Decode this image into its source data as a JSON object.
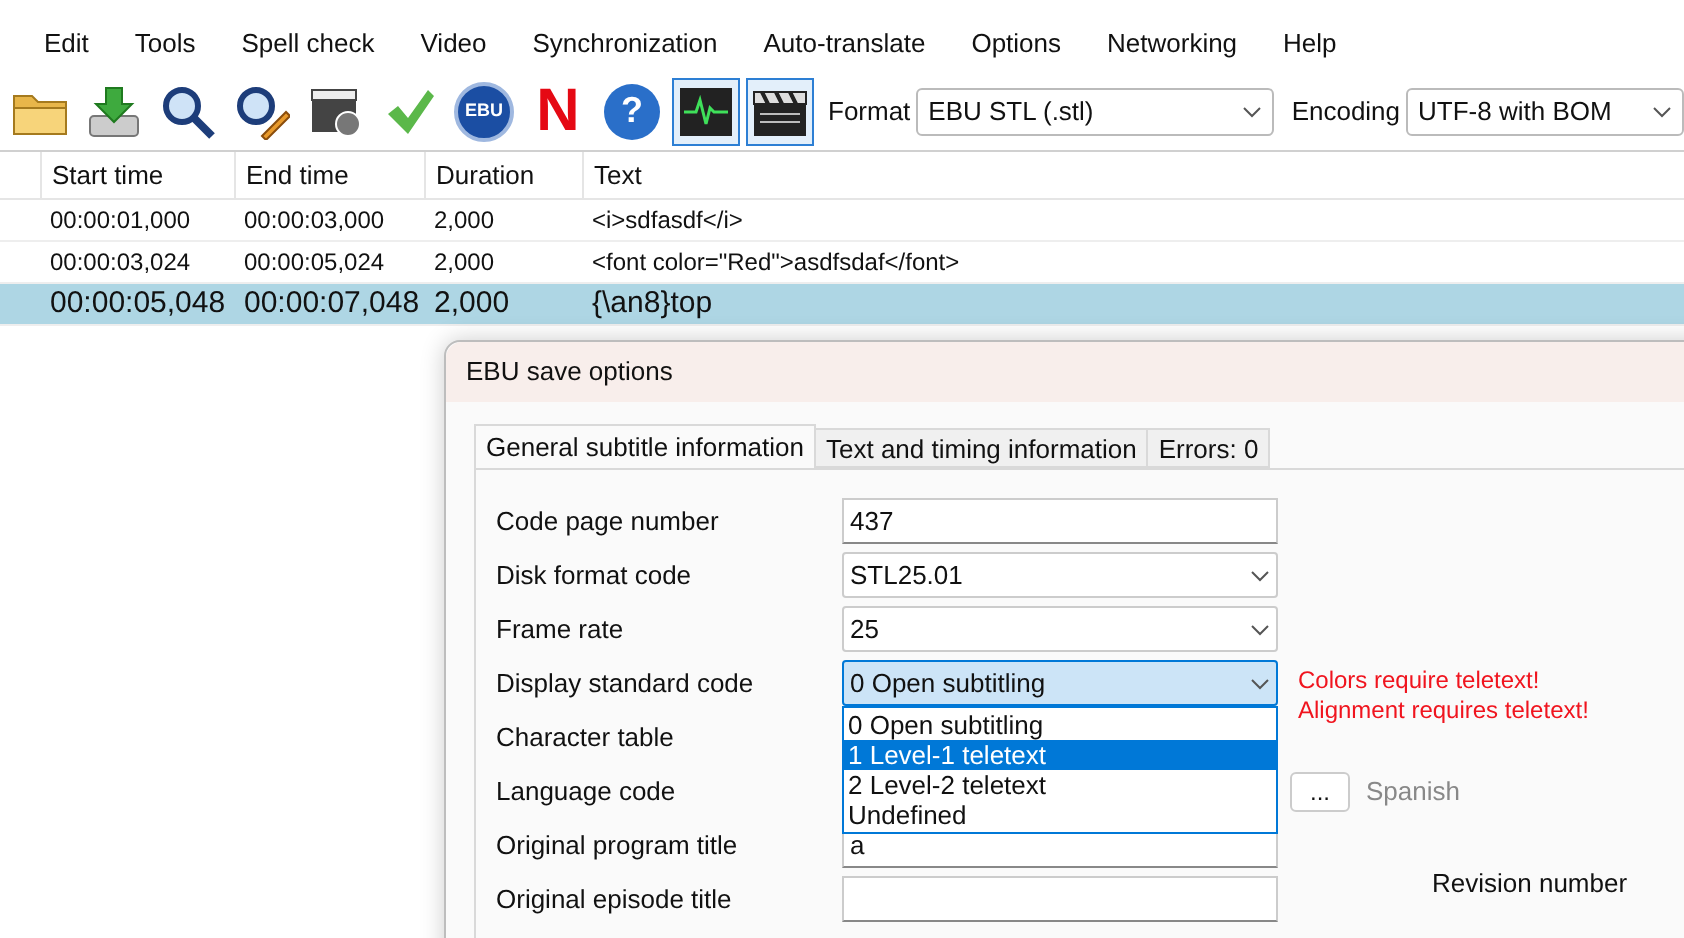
{
  "menu": [
    "Edit",
    "Tools",
    "Spell check",
    "Video",
    "Synchronization",
    "Auto-translate",
    "Options",
    "Networking",
    "Help"
  ],
  "toolbar": {
    "buttons": [
      {
        "kind": "folder"
      },
      {
        "kind": "download"
      },
      {
        "kind": "search"
      },
      {
        "kind": "replace"
      },
      {
        "kind": "clapper-clock"
      },
      {
        "kind": "check"
      },
      {
        "kind": "ebu",
        "text": "EBU",
        "pressed": false
      },
      {
        "kind": "netflix",
        "text": "N"
      },
      {
        "kind": "help",
        "text": "?"
      },
      {
        "kind": "waveform",
        "pressed": true
      },
      {
        "kind": "video",
        "pressed": true
      }
    ],
    "format": {
      "label": "Format",
      "value": "EBU STL (.stl)"
    },
    "encoding": {
      "label": "Encoding",
      "value": "UTF-8 with BOM"
    }
  },
  "table": {
    "columns": [
      "Start time",
      "End time",
      "Duration",
      "Text"
    ],
    "rows": [
      {
        "cells": [
          "00:00:01,000",
          "00:00:03,000",
          "2,000",
          "<i>sdfasdf</i>"
        ],
        "selected": false
      },
      {
        "cells": [
          "00:00:03,024",
          "00:00:05,024",
          "2,000",
          "<font color=\"Red\">asdfsdaf</font>"
        ],
        "selected": false
      },
      {
        "cells": [
          "00:00:05,048",
          "00:00:07,048",
          "2,000",
          "{\\an8}top"
        ],
        "selected": true
      }
    ]
  },
  "dialog": {
    "title": "EBU save options",
    "tabs": [
      {
        "label": "General subtitle information",
        "selected": true
      },
      {
        "label": "Text and timing information",
        "selected": false
      },
      {
        "label": "Errors: 0",
        "selected": false
      }
    ],
    "fields": [
      {
        "kind": "text",
        "label": "Code page number",
        "value": "437"
      },
      {
        "kind": "dropdown",
        "label": "Disk format code",
        "value": "STL25.01"
      },
      {
        "kind": "dropdown",
        "label": "Frame rate",
        "value": "25"
      },
      {
        "kind": "dropdown",
        "label": "Display standard code",
        "value": "0 Open subtitling",
        "open": true,
        "warnings": [
          "Colors require teletext!",
          "Alignment requires teletext!"
        ],
        "options": [
          {
            "label": "0 Open subtitling",
            "highlighted": false
          },
          {
            "label": "1 Level-1 teletext",
            "highlighted": true
          },
          {
            "label": "2 Level-2 teletext",
            "highlighted": false
          },
          {
            "label": "Undefined",
            "highlighted": false
          }
        ]
      },
      {
        "kind": "covered",
        "label": "Character table"
      },
      {
        "kind": "covered",
        "label": "Language code",
        "button": "...",
        "note": "Spanish"
      },
      {
        "kind": "text",
        "label": "Original program title",
        "value": "a"
      },
      {
        "kind": "text",
        "label": "Original episode title",
        "side_label": "Revision number"
      }
    ]
  }
}
